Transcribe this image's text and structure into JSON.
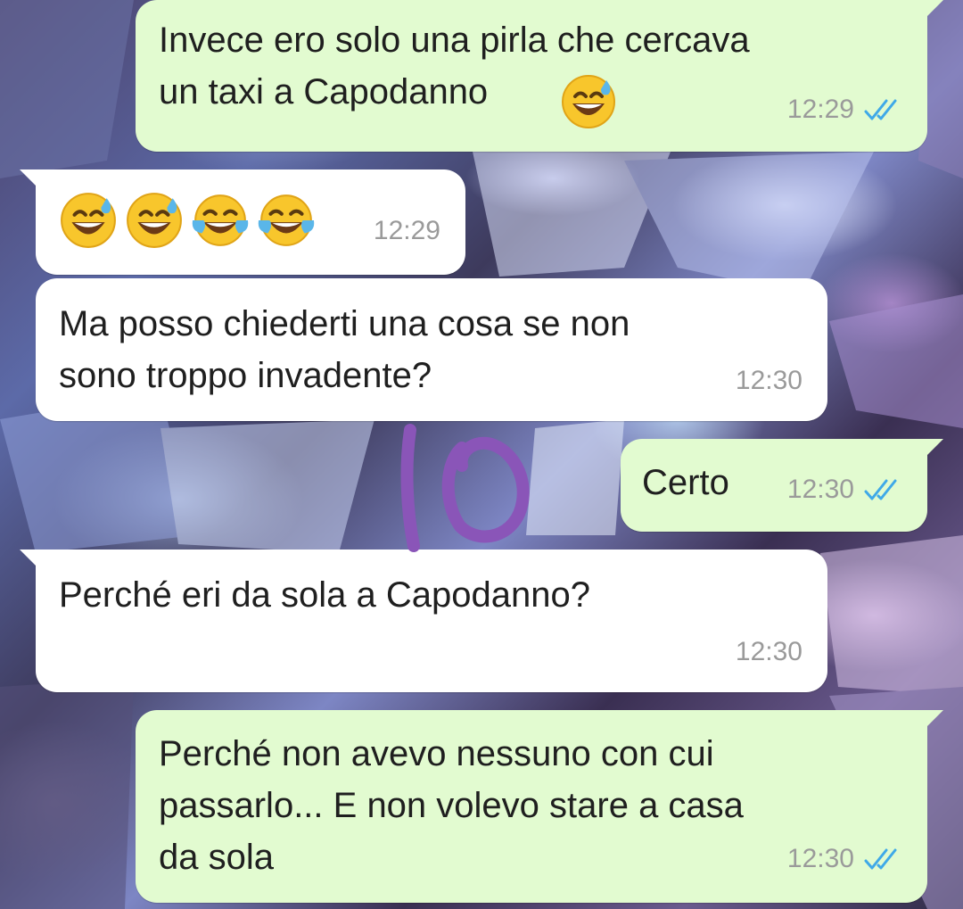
{
  "chat": {
    "messages": [
      {
        "direction": "outgoing",
        "text": "Invece ero solo una pirla che cercava\nun taxi a Capodanno",
        "emoji": [
          "grinning-face-with-sweat"
        ],
        "time": "12:29",
        "status": "read"
      },
      {
        "direction": "incoming",
        "emoji": [
          "grinning-face-with-sweat",
          "grinning-face-with-sweat",
          "face-with-tears-of-joy",
          "face-with-tears-of-joy"
        ],
        "time": "12:29"
      },
      {
        "direction": "incoming",
        "text": "Ma posso chiederti una cosa se non\nsono troppo invadente?",
        "time": "12:30"
      },
      {
        "direction": "outgoing",
        "text": "Certo",
        "time": "12:30",
        "status": "read"
      },
      {
        "direction": "incoming",
        "text": "Perché eri da sola a Capodanno?",
        "time": "12:30"
      },
      {
        "direction": "outgoing",
        "text": "Perché non avevo nessuno con cui\npassarlo... E non volevo stare a casa\nda sola",
        "time": "12:30",
        "status": "read"
      }
    ]
  },
  "annotation": {
    "text": "10",
    "color": "#8a55b8"
  },
  "colors": {
    "outgoing_bubble": "#e2fbd0",
    "incoming_bubble": "#ffffff",
    "timestamp": "#9a9a9a",
    "read_ticks": "#3fa9e8"
  }
}
